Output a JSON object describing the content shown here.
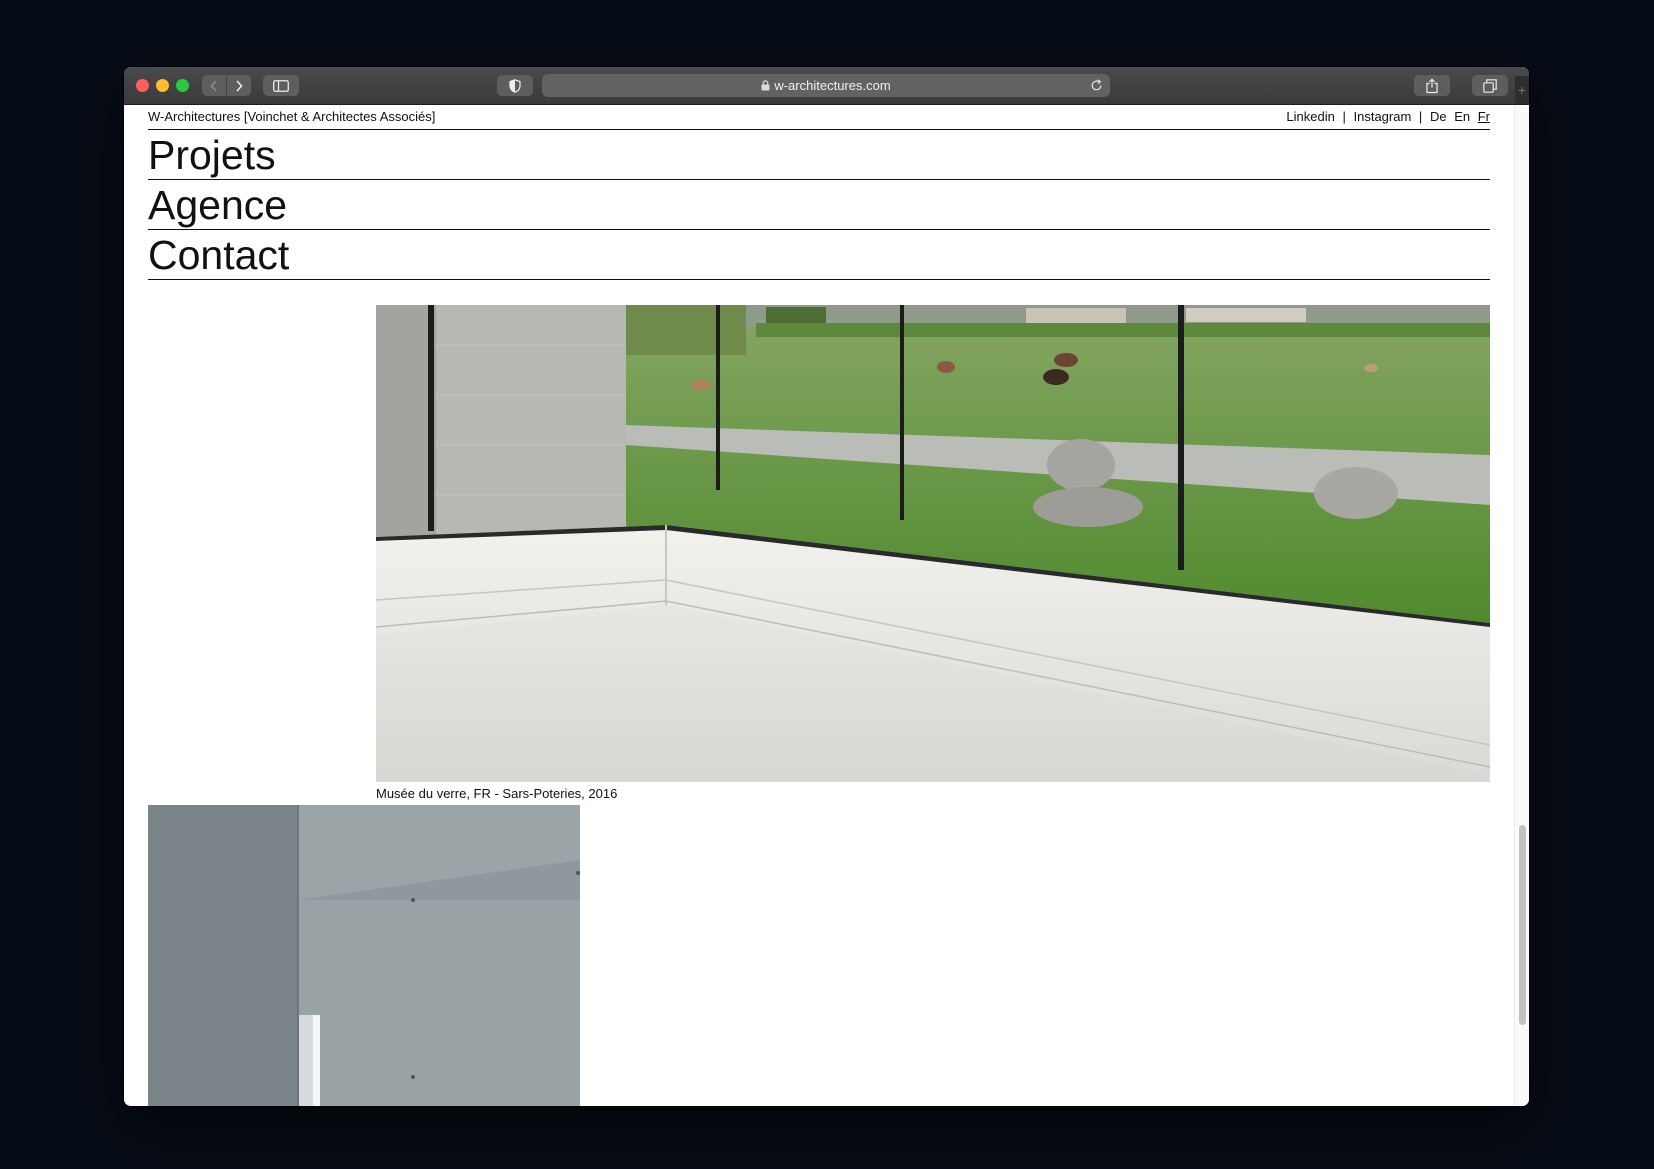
{
  "browser": {
    "url": "w-architectures.com",
    "back_glyph": "‹",
    "forward_glyph": "›",
    "newtab_glyph": "+"
  },
  "site": {
    "brand": "W-Architectures  [Voinchet & Architectes Associés]",
    "links": [
      "Linkedin",
      "|",
      "Instagram",
      "|",
      "De",
      "En",
      "Fr"
    ],
    "active_lang": "Fr"
  },
  "nav": {
    "projets": "Projets",
    "agence": "Agence",
    "contact": "Contact"
  },
  "gallery": {
    "main_caption": "Musée du verre, FR - Sars-Poteries, 2016"
  },
  "colors": {
    "page_bg": "#ffffff",
    "text": "#111111",
    "desktop_bg": "#070d17"
  }
}
